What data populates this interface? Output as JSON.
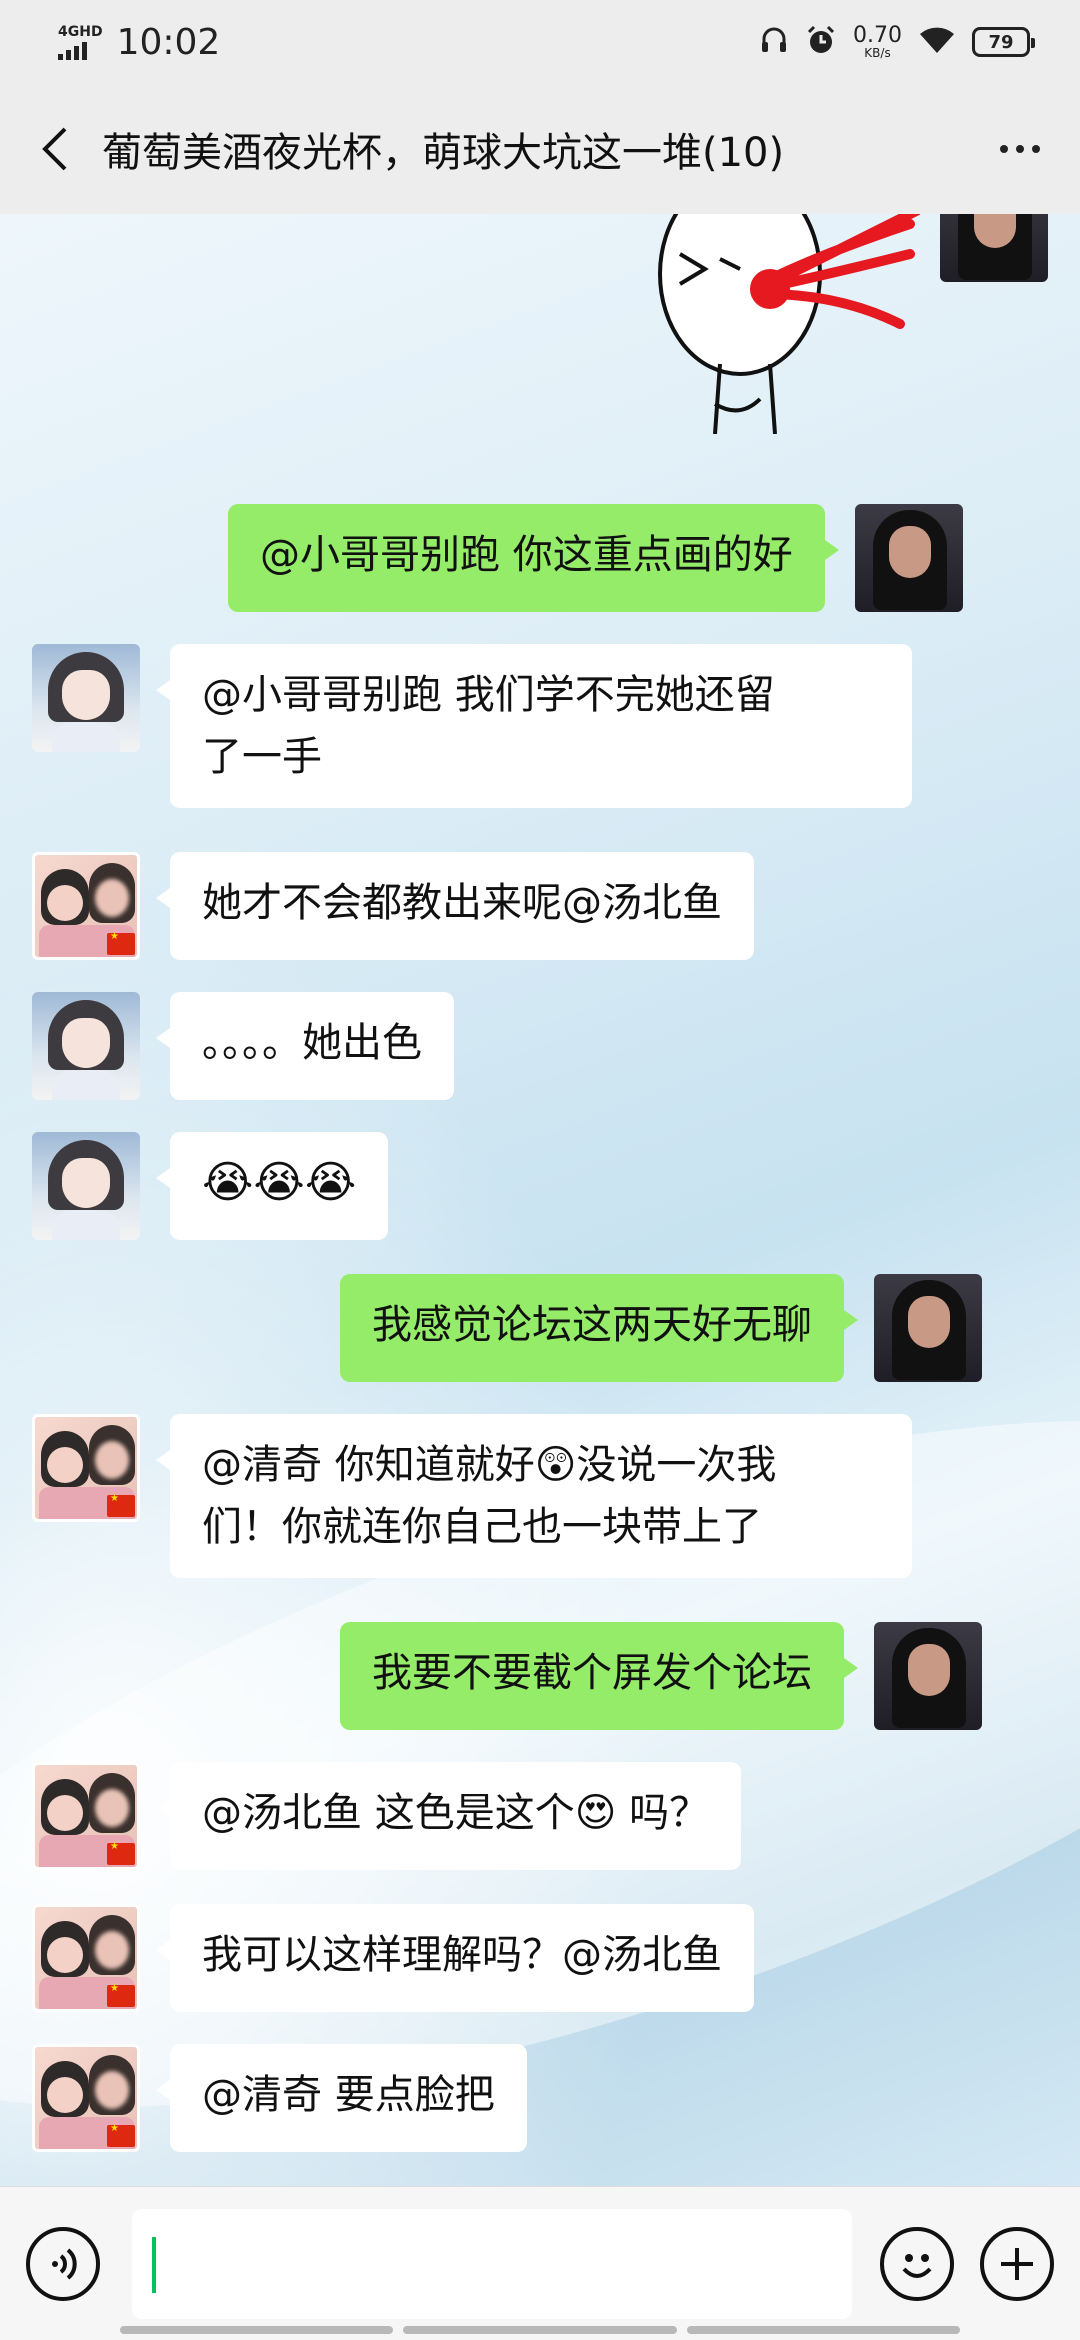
{
  "status_bar": {
    "network": "4GHD",
    "time": "10:02",
    "speed_value": "0.70",
    "speed_unit": "KB/s",
    "battery": "79"
  },
  "header": {
    "title": "葡萄美酒夜光杯，萌球大坑这一堆(10)"
  },
  "messages": [
    {
      "from": "me",
      "avatar": "me",
      "text": "@小哥哥别跑  你这重点画的好"
    },
    {
      "from": "other",
      "avatar": "girl",
      "text_line1": "@小哥哥别跑  我们学不完她还留",
      "text_line2": "了一手"
    },
    {
      "from": "other",
      "avatar": "duo",
      "text": "她才不会都教出来呢@汤北鱼"
    },
    {
      "from": "other",
      "avatar": "girl",
      "text": "。。。。她出色"
    },
    {
      "from": "other",
      "avatar": "girl",
      "emoji": "😭😭😭"
    },
    {
      "from": "me",
      "avatar": "me",
      "text": "我感觉论坛这两天好无聊"
    },
    {
      "from": "other",
      "avatar": "duo",
      "text_before_emoji": "@清奇  你知道就好",
      "emoji": "😲",
      "text_after_emoji": "没说一次我",
      "text_line2": "们！你就连你自己也一块带上了"
    },
    {
      "from": "me",
      "avatar": "me",
      "text": "我要不要截个屏发个论坛"
    },
    {
      "from": "other",
      "avatar": "duo",
      "text_before_emoji": "@汤北鱼  这色是这个",
      "emoji": "😍",
      "text_after_emoji": " 吗？"
    },
    {
      "from": "other",
      "avatar": "duo",
      "text": "我可以这样理解吗？@汤北鱼"
    },
    {
      "from": "other",
      "avatar": "duo",
      "text": "@清奇  要点脸把"
    }
  ],
  "input_bar": {
    "voice_icon": "voice-icon",
    "emoji_icon": "smiley-icon",
    "plus_icon": "plus-icon"
  },
  "colors": {
    "out_bubble": "#95ec69",
    "in_bubble": "#ffffff",
    "header_bg": "#ededed",
    "cursor": "#07c160"
  }
}
